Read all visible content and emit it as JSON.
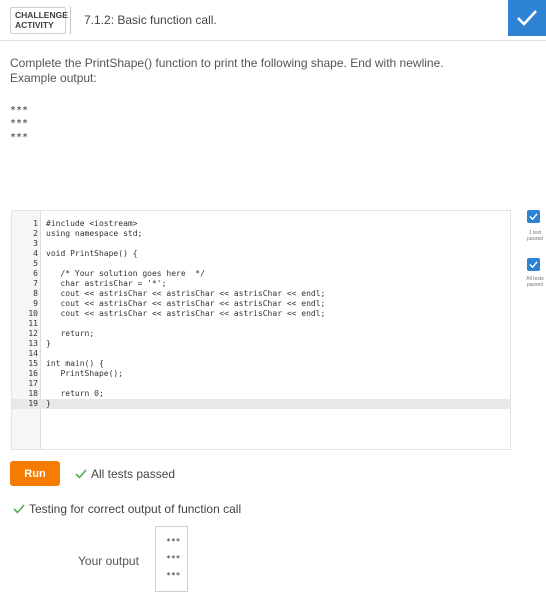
{
  "header": {
    "badge_line1": "CHALLENGE",
    "badge_line2": "ACTIVITY",
    "title": "7.1.2: Basic function call.",
    "complete_icon": "check-icon",
    "accent_color": "#2d82d3"
  },
  "instructions": {
    "line1": "Complete the PrintShape() function to print the following shape. End with newline.",
    "line2": "Example output:",
    "example_output": [
      "***",
      "***",
      "***"
    ]
  },
  "editor": {
    "lines": [
      {
        "n": "1",
        "code": "#include <iostream>"
      },
      {
        "n": "2",
        "code": "using namespace std;"
      },
      {
        "n": "3",
        "code": ""
      },
      {
        "n": "4",
        "code": "void PrintShape() {"
      },
      {
        "n": "5",
        "code": ""
      },
      {
        "n": "6",
        "code": "   /* Your solution goes here  */"
      },
      {
        "n": "7",
        "code": "   char astrisChar = '*';"
      },
      {
        "n": "8",
        "code": "   cout << astrisChar << astrisChar << astrisChar << endl;"
      },
      {
        "n": "9",
        "code": "   cout << astrisChar << astrisChar << astrisChar << endl;"
      },
      {
        "n": "10",
        "code": "   cout << astrisChar << astrisChar << astrisChar << endl;"
      },
      {
        "n": "11",
        "code": ""
      },
      {
        "n": "12",
        "code": "   return;"
      },
      {
        "n": "13",
        "code": "}"
      },
      {
        "n": "14",
        "code": ""
      },
      {
        "n": "15",
        "code": "int main() {"
      },
      {
        "n": "16",
        "code": "   PrintShape();"
      },
      {
        "n": "17",
        "code": ""
      },
      {
        "n": "18",
        "code": "   return 0;"
      },
      {
        "n": "19",
        "code": "}"
      }
    ],
    "active_line": "19"
  },
  "side": {
    "label1_line1": "1 test",
    "label1_line2": "passed",
    "label2_line1": "All tests",
    "label2_line2": "passed"
  },
  "run": {
    "button_label": "Run",
    "status": "All tests passed",
    "status_color": "#4caf50",
    "run_color": "#f57c00"
  },
  "result": {
    "testing_label": "Testing for correct output of function call",
    "output_label": "Your output",
    "output": [
      "***",
      "***",
      "***"
    ]
  }
}
